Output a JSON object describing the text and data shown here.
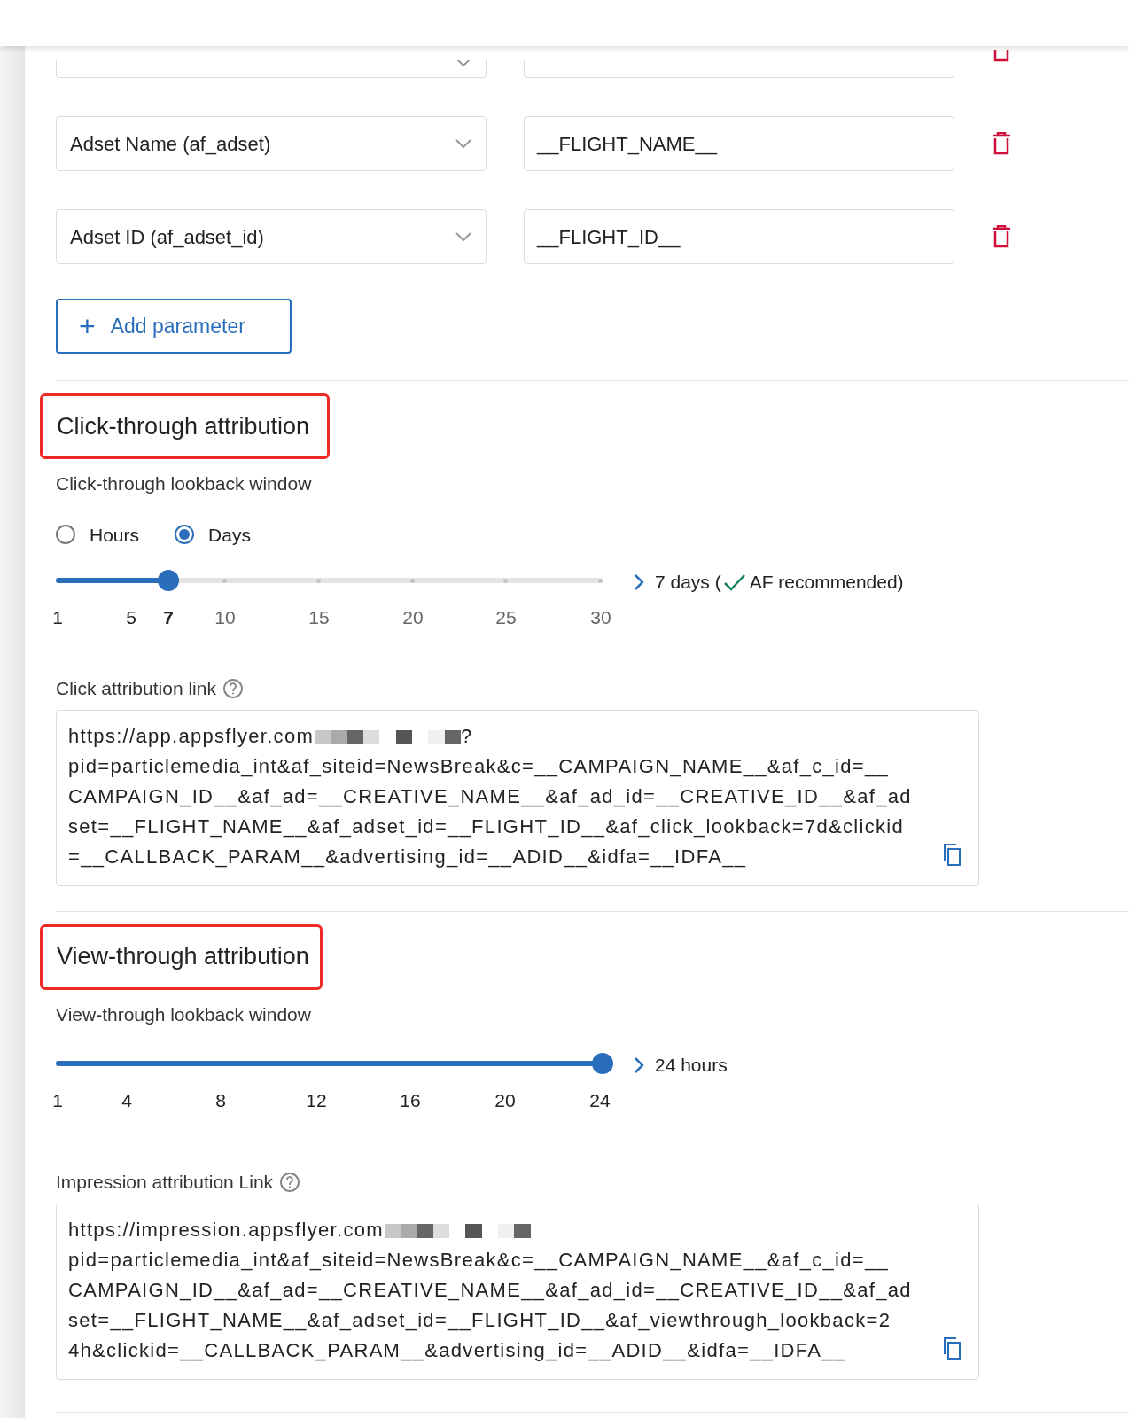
{
  "parameters": [
    {
      "kind": "cut"
    },
    {
      "name": "Adset Name (af_adset)",
      "value": "__FLIGHT_NAME__"
    },
    {
      "name": "Adset ID (af_adset_id)",
      "value": "__FLIGHT_ID__"
    }
  ],
  "add_button": {
    "icon": "+",
    "label": "Add parameter"
  },
  "sections": [
    {
      "kind": "click",
      "title": "Click-through attribution",
      "subtitle": "Click-through lookback window",
      "units": [
        {
          "label": "Hours",
          "selected": false
        },
        {
          "label": "Days",
          "selected": true
        }
      ],
      "slider": {
        "level": 0.206,
        "ticks": [
          {
            "label": "1",
            "selected": false
          },
          {
            "label": "5",
            "selected": false
          },
          {
            "label": "7",
            "selected": true
          },
          {
            "label": "10",
            "selected": false
          },
          {
            "label": "15",
            "selected": false
          },
          {
            "label": "20",
            "selected": false
          },
          {
            "label": "25",
            "selected": false
          },
          {
            "label": "30",
            "selected": false
          }
        ],
        "result": "7 days (",
        "result_note": "AF recommended)",
        "recommended": true
      },
      "link_label": "Click attribution link",
      "link_prefix": "https://app.appsflyer.com",
      "link_suffix": "?",
      "link_lines": [
        "pid=particlemedia_int&af_siteid=NewsBreak&c=__CAMPAIGN_NAME__&af_c_id=__",
        "CAMPAIGN_ID__&af_ad=__CREATIVE_NAME__&af_ad_id=__CREATIVE_ID__&af_ad",
        "set=__FLIGHT_NAME__&af_adset_id=__FLIGHT_ID__&af_click_lookback=7d&clickid",
        "=__CALLBACK_PARAM__&advertising_id=__ADID__&idfa=__IDFA__"
      ]
    },
    {
      "kind": "view",
      "title": "View-through attribution",
      "subtitle": "View-through lookback window",
      "slider": {
        "level": 1.0,
        "ticks": [
          {
            "label": "1",
            "selected": false
          },
          {
            "label": "4",
            "selected": false
          },
          {
            "label": "8",
            "selected": false
          },
          {
            "label": "12",
            "selected": false
          },
          {
            "label": "16",
            "selected": false
          },
          {
            "label": "20",
            "selected": false
          },
          {
            "label": "24",
            "selected": false
          }
        ],
        "result": "24 hours"
      },
      "link_label": "Impression attribution Link",
      "link_prefix": "https://impression.appsflyer.com",
      "link_lines": [
        "pid=particlemedia_int&af_siteid=NewsBreak&c=__CAMPAIGN_NAME__&af_c_id=__",
        "CAMPAIGN_ID__&af_ad=__CREATIVE_NAME__&af_ad_id=__CREATIVE_ID__&af_ad",
        "set=__FLIGHT_NAME__&af_adset_id=__FLIGHT_ID__&af_viewthrough_lookback=2",
        "4h&clickid=__CALLBACK_PARAM__&advertising_id=__ADID__&idfa=__IDFA__"
      ]
    }
  ]
}
